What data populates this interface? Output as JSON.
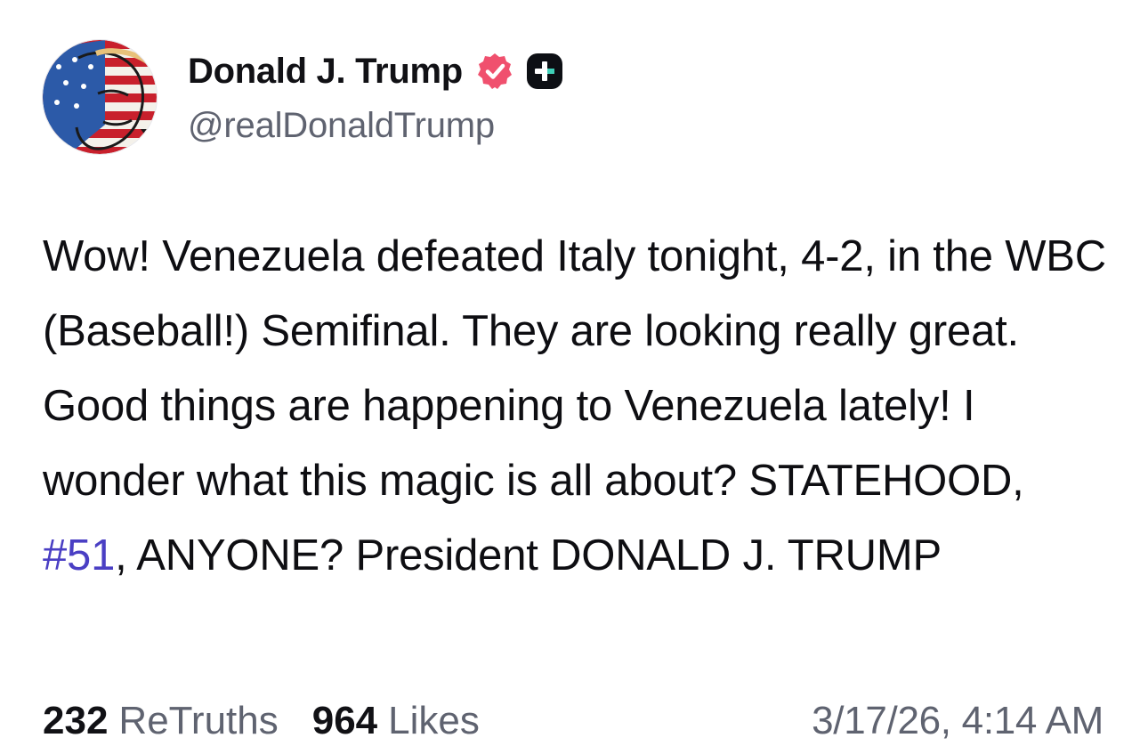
{
  "author": {
    "display_name": "Donald J. Trump",
    "handle": "@realDonaldTrump",
    "avatar_icon": "flag-portrait-avatar",
    "verified_icon": "verified-badge-icon",
    "verified_color": "#f0506e",
    "plus_icon": "truth-plus-icon"
  },
  "post": {
    "text_before_hashtag": "Wow! Venezuela defeated Italy tonight, 4-2, in the WBC (Baseball!) Semifinal. They are looking really great. Good things are happening to Venezuela lately! I wonder what this magic is all about? STATEHOOD, ",
    "hashtag": "#51",
    "text_after_hashtag": ", ANYONE? President DONALD J. TRUMP",
    "hashtag_color": "#4a3fc4"
  },
  "stats": {
    "retruths_count": "232",
    "retruths_label": "ReTruths",
    "likes_count": "964",
    "likes_label": "Likes",
    "timestamp": "3/17/26, 4:14 AM"
  }
}
